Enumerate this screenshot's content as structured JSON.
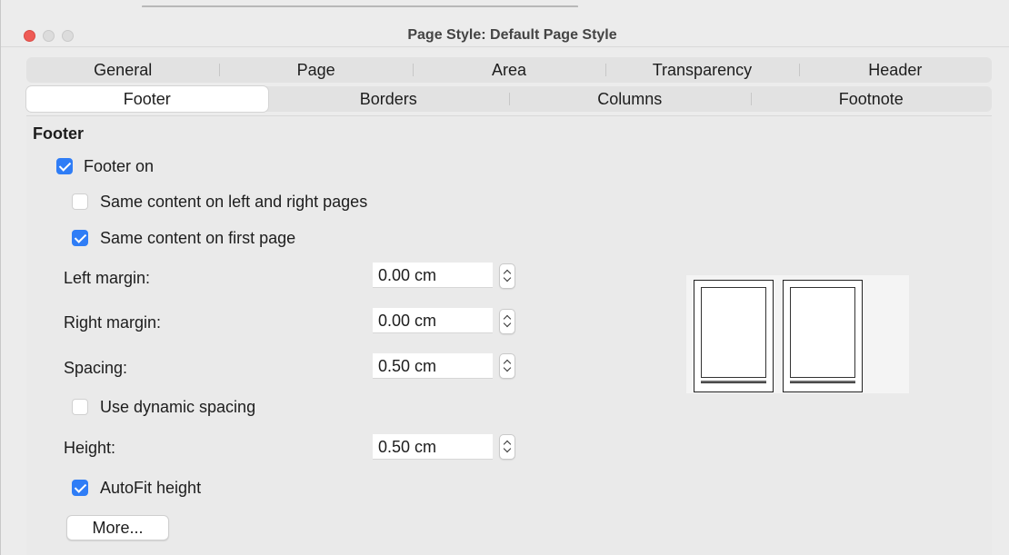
{
  "window": {
    "title": "Page Style: Default Page Style"
  },
  "tabs": {
    "row1": [
      "General",
      "Page",
      "Area",
      "Transparency",
      "Header"
    ],
    "row2": [
      "Footer",
      "Borders",
      "Columns",
      "Footnote"
    ],
    "active": "Footer"
  },
  "footer": {
    "section_title": "Footer",
    "footer_on": {
      "label": "Footer on",
      "checked": true
    },
    "same_left_right": {
      "label": "Same content on left and right pages",
      "checked": false
    },
    "same_first_page": {
      "label": "Same content on first page",
      "checked": true
    },
    "left_margin": {
      "label": "Left margin:",
      "value": "0.00 cm"
    },
    "right_margin": {
      "label": "Right margin:",
      "value": "0.00 cm"
    },
    "spacing": {
      "label": "Spacing:",
      "value": "0.50 cm"
    },
    "dynamic_spacing": {
      "label": "Use dynamic spacing",
      "checked": false
    },
    "height": {
      "label": "Height:",
      "value": "0.50 cm"
    },
    "autofit": {
      "label": "AutoFit height",
      "checked": true
    },
    "more_button": "More..."
  },
  "colors": {
    "accent": "#2f7df6",
    "close": "#ee5b55"
  }
}
